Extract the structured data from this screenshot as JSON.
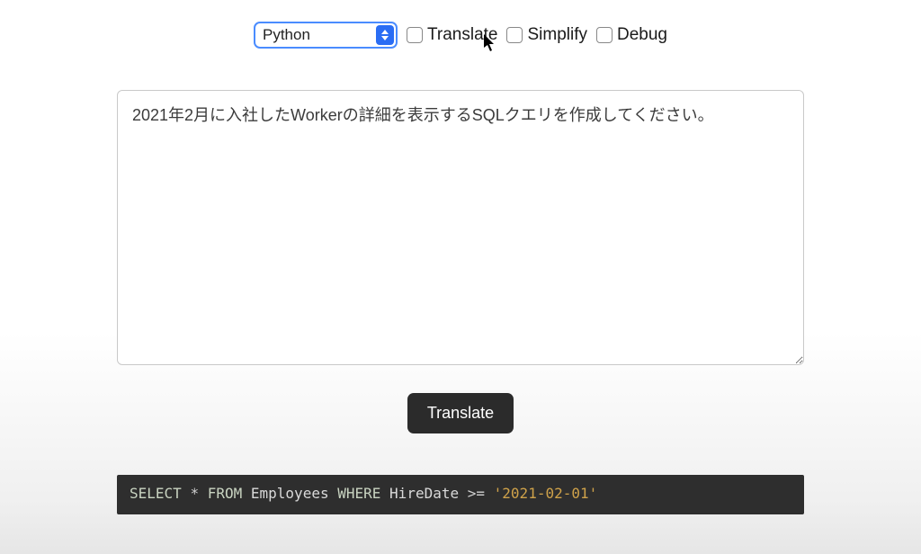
{
  "controls": {
    "language_select": {
      "selected": "Python"
    },
    "checkboxes": [
      {
        "label": "Translate",
        "checked": false
      },
      {
        "label": "Simplify",
        "checked": false
      },
      {
        "label": "Debug",
        "checked": false
      }
    ]
  },
  "prompt": {
    "value": "2021年2月に入社したWorkerの詳細を表示するSQLクエリを作成してください。"
  },
  "action_button": {
    "label": "Translate"
  },
  "result_sql": {
    "tokens": [
      {
        "t": "kw",
        "v": "SELECT"
      },
      {
        "t": "sp",
        "v": " "
      },
      {
        "t": "star",
        "v": "*"
      },
      {
        "t": "sp",
        "v": " "
      },
      {
        "t": "kw",
        "v": "FROM"
      },
      {
        "t": "sp",
        "v": " "
      },
      {
        "t": "ident",
        "v": "Employees"
      },
      {
        "t": "sp",
        "v": " "
      },
      {
        "t": "kw",
        "v": "WHERE"
      },
      {
        "t": "sp",
        "v": " "
      },
      {
        "t": "ident",
        "v": "HireDate"
      },
      {
        "t": "sp",
        "v": " "
      },
      {
        "t": "op",
        "v": ">="
      },
      {
        "t": "sp",
        "v": " "
      },
      {
        "t": "str",
        "v": "'2021-02-01'"
      }
    ]
  }
}
